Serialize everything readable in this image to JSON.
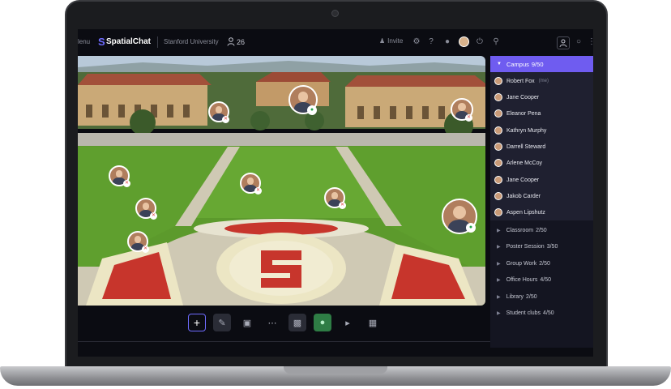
{
  "topbar": {
    "menu_label": "Menu",
    "menu_visible_text": "lenu",
    "app_name": "SpatialChat",
    "org_name": "Stanford University",
    "user_count": "26",
    "invite_label": "Invite"
  },
  "colors": {
    "accent": "#6f5cf0",
    "mic_active": "#2e7d45",
    "muted": "#e04b4b",
    "sidebar_bg": "#141521"
  },
  "map": {
    "description_icon": "campus-aerial-map"
  },
  "toolbar": {
    "tools": [
      {
        "name": "add",
        "icon": "plus-icon"
      },
      {
        "name": "pen",
        "icon": "pencil-icon"
      },
      {
        "name": "screen",
        "icon": "screen-share-icon"
      },
      {
        "name": "chat",
        "icon": "chat-icon"
      },
      {
        "name": "camera",
        "icon": "camera-off-icon"
      },
      {
        "name": "mic",
        "icon": "microphone-icon"
      },
      {
        "name": "speaker",
        "icon": "speaker-icon"
      },
      {
        "name": "apps",
        "icon": "apps-grid-icon"
      }
    ]
  },
  "sidebar": {
    "active_room": {
      "name": "Campus",
      "count": "9/50"
    },
    "members": [
      {
        "name": "Robert Fox",
        "tag": "(me)"
      },
      {
        "name": "Jane Cooper",
        "tag": ""
      },
      {
        "name": "Eleanor Pena",
        "tag": ""
      },
      {
        "name": "Kathryn Murphy",
        "tag": ""
      },
      {
        "name": "Darrell Steward",
        "tag": ""
      },
      {
        "name": "Arlene McCoy",
        "tag": ""
      },
      {
        "name": "Jane Cooper",
        "tag": ""
      },
      {
        "name": "Jakob Carder",
        "tag": ""
      },
      {
        "name": "Aspen Lipshutz",
        "tag": ""
      }
    ],
    "rooms": [
      {
        "name": "Classroom",
        "count": "2/50"
      },
      {
        "name": "Poster Session",
        "count": "3/50"
      },
      {
        "name": "Group Work",
        "count": "2/50"
      },
      {
        "name": "Office Hours",
        "count": "4/50"
      },
      {
        "name": "Library",
        "count": "2/50"
      },
      {
        "name": "Student clubs",
        "count": "4/50"
      }
    ]
  }
}
